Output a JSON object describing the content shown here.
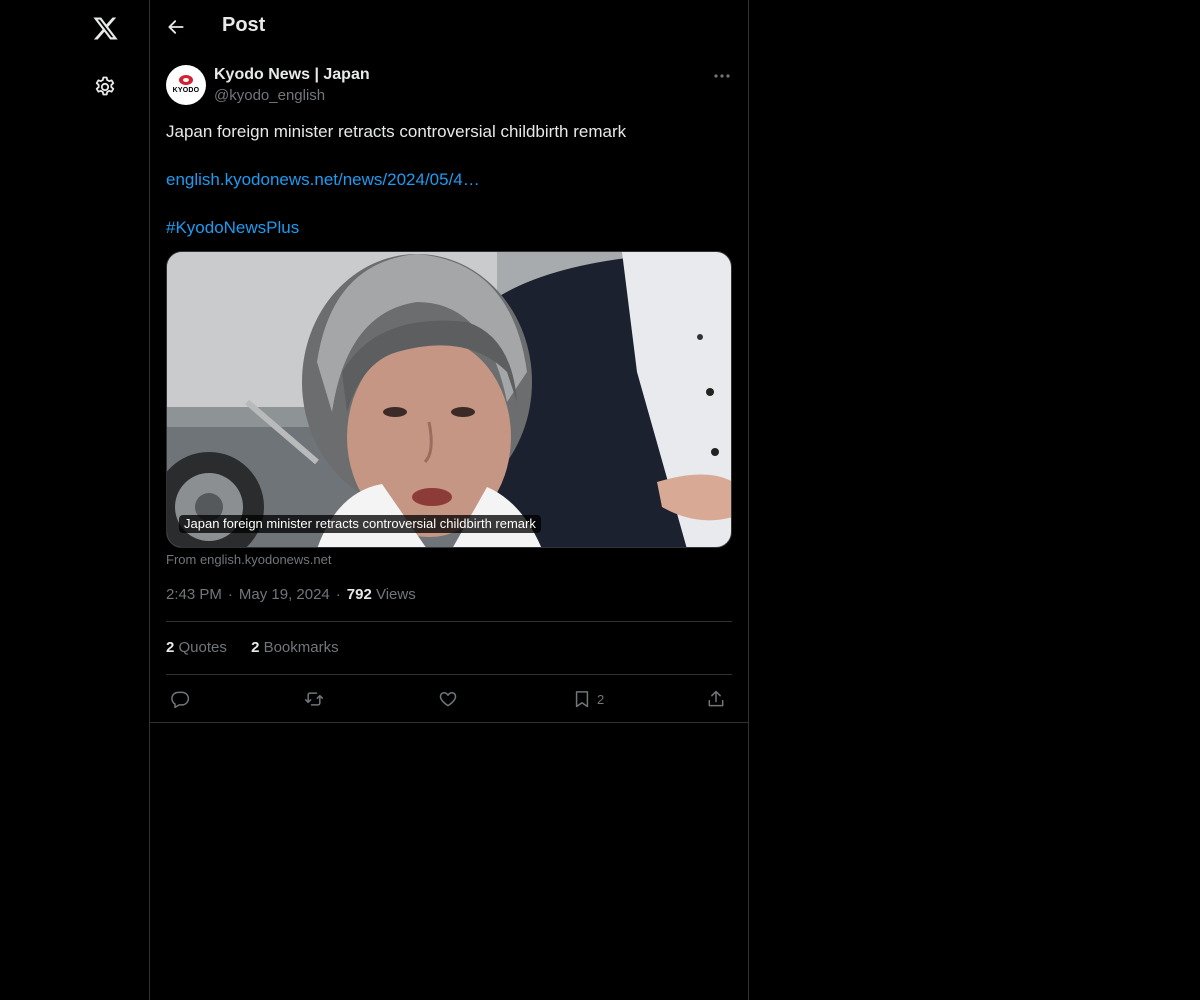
{
  "nav": {
    "logo_icon": "x-logo-icon",
    "settings_icon": "gear-icon"
  },
  "header": {
    "back_icon": "arrow-left-icon",
    "title": "Post"
  },
  "post": {
    "author": {
      "name": "Kyodo News | Japan",
      "handle": "@kyodo_english",
      "avatar_text": "KYODO"
    },
    "text": "Japan foreign minister retracts controversial childbirth remark",
    "link": "english.kyodonews.net/news/2024/05/4…",
    "hashtag": "#KyodoNewsPlus",
    "card": {
      "caption": "Japan foreign minister retracts controversial childbirth remark",
      "source": "From english.kyodonews.net"
    },
    "meta": {
      "time": "2:43 PM",
      "separator": "·",
      "date": "May 19, 2024",
      "views_count": "792",
      "views_label": "Views"
    },
    "stats": {
      "quotes_count": "2",
      "quotes_label": "Quotes",
      "bookmarks_count": "2",
      "bookmarks_label": "Bookmarks"
    },
    "actions": {
      "bookmark_count": "2"
    }
  },
  "colors": {
    "background": "#000000",
    "text": "#e7e9ea",
    "secondary": "#71767b",
    "link": "#1d9bf0",
    "border": "#2f3336"
  }
}
